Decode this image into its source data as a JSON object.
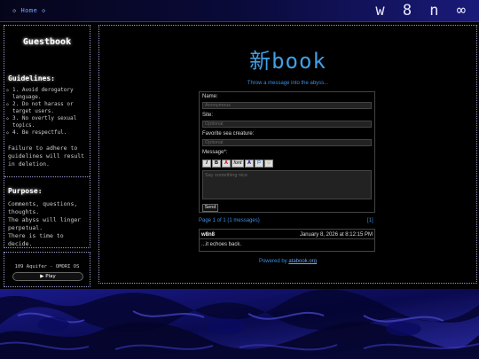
{
  "topbar": {
    "home_diamond_left": "◇",
    "home_label": "Home",
    "home_diamond_right": "◇",
    "logo": "w 8 n ∞"
  },
  "sidebar": {
    "title": "Guestbook",
    "guidelines_heading": "Guidelines:",
    "guidelines": [
      "1. Avoid derogatory language.",
      "2. Do not harass or target users.",
      "3. No overtly sexual topics.",
      "4. Be respectful."
    ],
    "warning": "Failure to adhere to guidelines will result in deletion.",
    "purpose_heading": "Purpose:",
    "purpose_lines": [
      "Comments, questions, thoughts.",
      "The abyss will linger perpetual.",
      "There is time to decide."
    ]
  },
  "player": {
    "track": "109 Aquifer - OMORI OS",
    "play_label": "▶ Play"
  },
  "main": {
    "book_title": "新book",
    "prompt": "Throw a message into the abyss...",
    "form": {
      "name_label": "Name:",
      "name_placeholder": "Anonymous",
      "site_label": "Site:",
      "site_placeholder": "Optional",
      "creature_label": "Favorite sea creature:",
      "creature_placeholder": "Optional",
      "message_label": "Message*:",
      "message_placeholder": "Say something nice",
      "toolbar": [
        "I",
        "B",
        "A",
        "font",
        "A",
        "⚐",
        "☺"
      ],
      "send_label": "Send"
    },
    "pagination": {
      "info": "Page 1 of 1 (1 messages)",
      "current": "[1]"
    },
    "entries": [
      {
        "name": "w8n8",
        "date": "January 8, 2026 at 8:12:15 PM",
        "message": "...it echoes back."
      }
    ],
    "powered_prefix": "Powered by ",
    "powered_link": "atabook.org"
  }
}
